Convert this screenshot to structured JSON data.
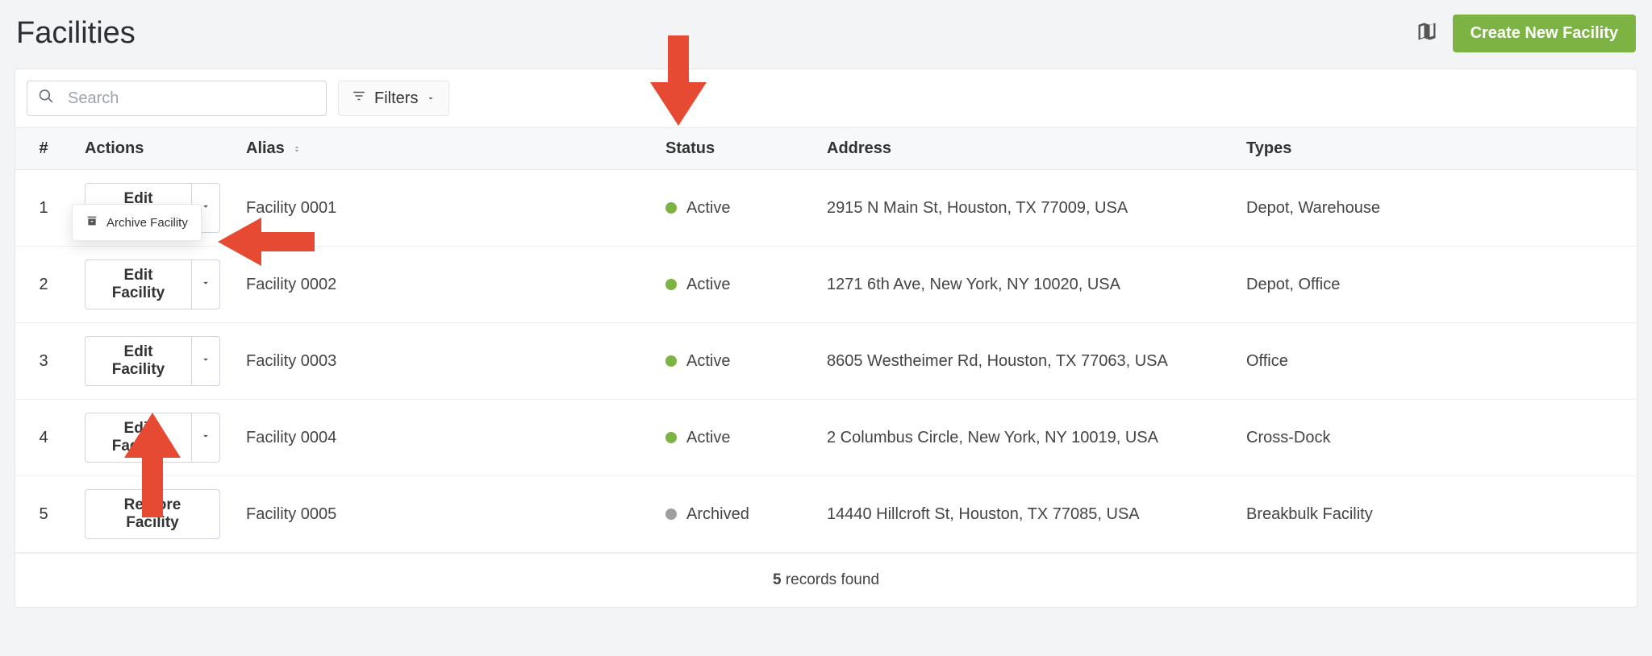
{
  "header": {
    "title": "Facilities",
    "create_label": "Create New Facility"
  },
  "toolbar": {
    "search_placeholder": "Search",
    "filters_label": "Filters"
  },
  "table": {
    "columns": {
      "idx": "#",
      "actions": "Actions",
      "alias": "Alias",
      "status": "Status",
      "address": "Address",
      "types": "Types"
    },
    "action_labels": {
      "edit": "Edit Facility",
      "restore": "Restore Facility",
      "archive": "Archive Facility"
    },
    "status_labels": {
      "active": "Active",
      "archived": "Archived"
    },
    "rows": [
      {
        "idx": "1",
        "alias": "Facility 0001",
        "status": "active",
        "address": "2915 N Main St, Houston, TX 77009, USA",
        "types": "Depot, Warehouse"
      },
      {
        "idx": "2",
        "alias": "Facility 0002",
        "status": "active",
        "address": "1271 6th Ave, New York, NY 10020, USA",
        "types": "Depot, Office"
      },
      {
        "idx": "3",
        "alias": "Facility 0003",
        "status": "active",
        "address": "8605 Westheimer Rd, Houston, TX 77063, USA",
        "types": "Office"
      },
      {
        "idx": "4",
        "alias": "Facility 0004",
        "status": "active",
        "address": "2 Columbus Circle, New York, NY 10019, USA",
        "types": "Cross-Dock"
      },
      {
        "idx": "5",
        "alias": "Facility 0005",
        "status": "archived",
        "address": "14440 Hillcroft St, Houston, TX 77085, USA",
        "types": "Breakbulk Facility"
      }
    ]
  },
  "footer": {
    "count": "5",
    "suffix": "records found"
  },
  "colors": {
    "accent": "#7cb342",
    "archived": "#9e9e9e",
    "arrow": "#e74a33"
  }
}
